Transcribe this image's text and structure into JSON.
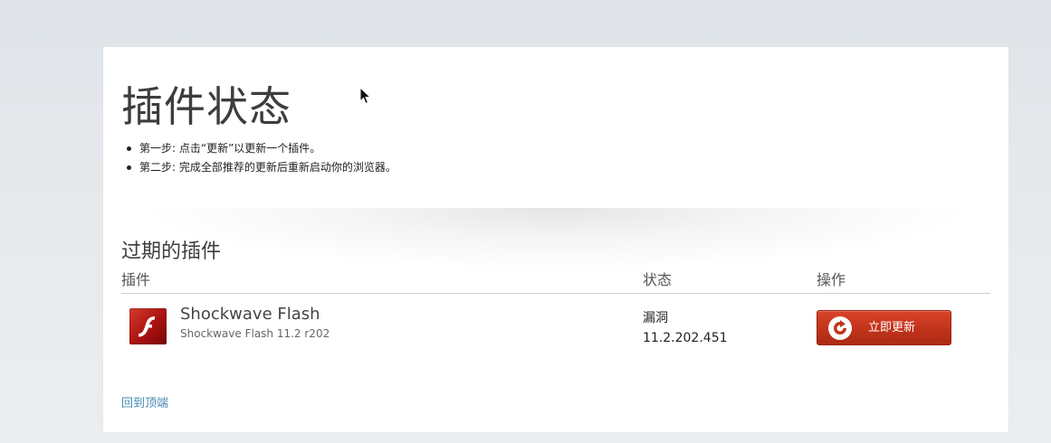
{
  "page": {
    "title": "插件状态",
    "steps": [
      "第一步: 点击“更新”以更新一个插件。",
      "第二步: 完成全部推荐的更新后重新启动你的浏览器。"
    ]
  },
  "outdated_section": {
    "title": "过期的插件",
    "columns": {
      "plugin": "插件",
      "status": "状态",
      "action": "操作"
    },
    "plugins": [
      {
        "name": "Shockwave Flash",
        "version_text": "Shockwave Flash 11.2 r202",
        "status": "漏洞",
        "status_version": "11.2.202.451",
        "action_label": "立即更新",
        "icon": "flash-icon"
      }
    ]
  },
  "footer": {
    "back_to_top": "回到顶端"
  },
  "colors": {
    "accent_button": "#c1331b",
    "link": "#4a8ab3",
    "card_bg": "#ffffff"
  }
}
